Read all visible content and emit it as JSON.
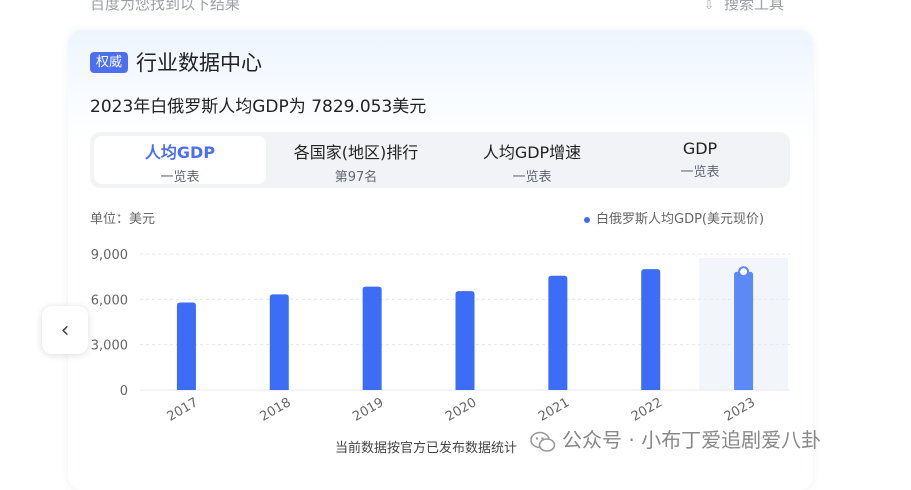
{
  "top": {
    "left_text": "百度为您找到以下结果",
    "right_text": "搜索工具"
  },
  "card": {
    "badge": "权威",
    "title": "行业数据中心",
    "headline_prefix": "2023年白俄罗斯人均GDP为",
    "headline_value": "7829.053美元"
  },
  "tabs": [
    {
      "label": "人均GDP",
      "sub": "一览表"
    },
    {
      "label": "各国家(地区)排行",
      "sub": "第97名"
    },
    {
      "label": "人均GDP增速",
      "sub": "一览表"
    },
    {
      "label": "GDP",
      "sub": "一览表"
    }
  ],
  "unit_label": "单位：美元",
  "legend_label": "白俄罗斯人均GDP(美元现价)",
  "colors": {
    "accent": "#4e6ef2",
    "bar": "#3d6cf6",
    "bar_highlight": "#5b8af7"
  },
  "chart_data": {
    "type": "bar",
    "categories": [
      "2017",
      "2018",
      "2019",
      "2020",
      "2021",
      "2022",
      "2023"
    ],
    "values": [
      5790,
      6330,
      6840,
      6540,
      7560,
      8000,
      7829.053
    ],
    "ylim": [
      0,
      9000
    ],
    "yticks": [
      0,
      3000,
      6000,
      9000
    ],
    "ytick_labels": [
      "0",
      "3,000",
      "6,000",
      "9,000"
    ],
    "grid": true,
    "highlighted_index": 6,
    "legend_position": "top-right"
  },
  "footnote": "当前数据按官方已发布数据统计",
  "watermark": "公众号 · 小布丁爱追剧爱八卦",
  "icons": {
    "prev": "chevron-left-icon",
    "tools": "filter-icon",
    "watermark": "wechat-icon"
  }
}
